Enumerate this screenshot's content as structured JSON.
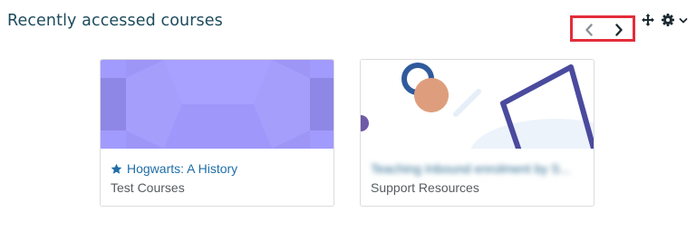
{
  "block": {
    "title": "Recently accessed courses"
  },
  "navigation": {
    "prev_icon": "chevron-left-icon",
    "next_icon": "chevron-right-icon"
  },
  "controls": {
    "move_icon": "move-icon",
    "settings_icon": "gear-icon",
    "menu_icon": "caret-down-icon"
  },
  "courses": [
    {
      "name": "Hogwarts: A History",
      "category": "Test Courses",
      "starred": true,
      "star_icon": "star-icon",
      "image_color": "#a29bfe"
    },
    {
      "name": "Teaching Inbound enrolment by S...",
      "category": "Support Resources",
      "starred": false,
      "name_blurred": true
    }
  ],
  "colors": {
    "title": "#1d4b5c",
    "link": "#1f6ea8",
    "highlight_border": "#e42d3a",
    "muted_text": "#555c61"
  }
}
